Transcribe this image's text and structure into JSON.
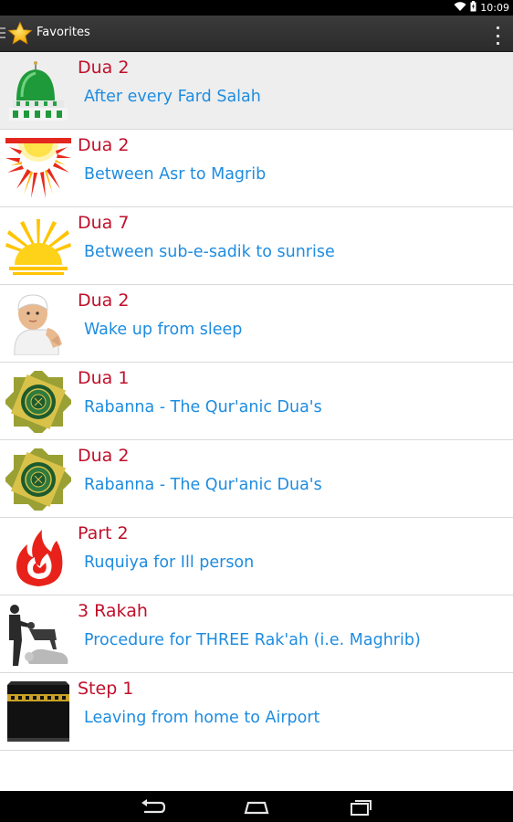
{
  "status_bar": {
    "time": "10:09",
    "icons": [
      "wifi-icon",
      "battery-icon"
    ]
  },
  "action_bar": {
    "title": "Favorites",
    "icon": "star-icon",
    "overflow_icon": "overflow-menu-icon"
  },
  "favorites": [
    {
      "title": "Dua 2",
      "subtitle": "After every Fard Salah",
      "icon": "green-dome-icon"
    },
    {
      "title": "Dua 2",
      "subtitle": "Between Asr to Magrib",
      "icon": "sunset-icon"
    },
    {
      "title": "Dua 7",
      "subtitle": "Between sub-e-sadik to sunrise",
      "icon": "sunrise-icon"
    },
    {
      "title": "Dua 2",
      "subtitle": "Wake up from sleep",
      "icon": "praying-boy-icon"
    },
    {
      "title": "Dua 1",
      "subtitle": "Rabanna - The Qur'anic Dua's",
      "icon": "islamic-star-emblem-icon"
    },
    {
      "title": "Dua 2",
      "subtitle": "Rabanna - The Qur'anic Dua's",
      "icon": "islamic-star-emblem-icon"
    },
    {
      "title": "Part 2",
      "subtitle": "Ruquiya for Ill person",
      "icon": "flame-icon"
    },
    {
      "title": "3 Rakah",
      "subtitle": "Procedure for THREE Rak'ah (i.e. Maghrib)",
      "icon": "prayer-posture-icon"
    },
    {
      "title": "Step 1",
      "subtitle": "Leaving from home to Airport",
      "icon": "kaaba-icon"
    }
  ],
  "nav_bar": {
    "buttons": [
      "back-icon",
      "home-icon",
      "recent-apps-icon"
    ]
  }
}
